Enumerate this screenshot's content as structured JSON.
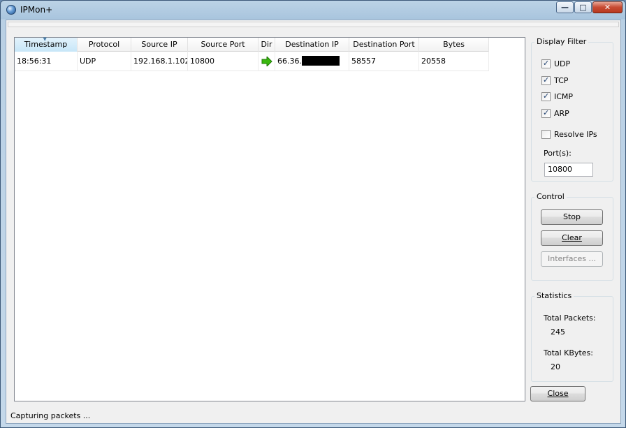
{
  "window": {
    "title": "IPMon+"
  },
  "caption_buttons": {
    "minimize": "—",
    "maximize": "□",
    "close": "✕"
  },
  "table": {
    "columns": [
      "Timestamp",
      "Protocol",
      "Source IP",
      "Source Port",
      "Dir",
      "Destination IP",
      "Destination Port",
      "Bytes"
    ],
    "sorted_column": "Timestamp",
    "rows": [
      {
        "timestamp": "18:56:31",
        "protocol": "UDP",
        "source_ip": "192.168.1.102",
        "source_port": "10800",
        "dir_icon": "green-right-arrow",
        "destination_ip_prefix": "66.36.",
        "destination_port": "58557",
        "bytes": "20558"
      }
    ]
  },
  "display_filter": {
    "label": "Display Filter",
    "options": [
      {
        "label": "UDP",
        "checked": true
      },
      {
        "label": "TCP",
        "checked": true
      },
      {
        "label": "ICMP",
        "checked": true
      },
      {
        "label": "ARP",
        "checked": true
      },
      {
        "label": "Resolve IPs",
        "checked": false
      }
    ],
    "ports_label": "Port(s):",
    "ports_value": "10800"
  },
  "control": {
    "label": "Control",
    "stop": "Stop",
    "clear": "Clear",
    "interfaces": "Interfaces ..."
  },
  "statistics": {
    "label": "Statistics",
    "total_packets_label": "Total Packets:",
    "total_packets": "245",
    "total_kbytes_label": "Total KBytes:",
    "total_kbytes": "20"
  },
  "close_button": "Close",
  "status_text": "Capturing packets ...",
  "colors": {
    "accent": "#4d7ea8",
    "arrow": "#3ab80e",
    "titlebar": "#a9c5de"
  }
}
